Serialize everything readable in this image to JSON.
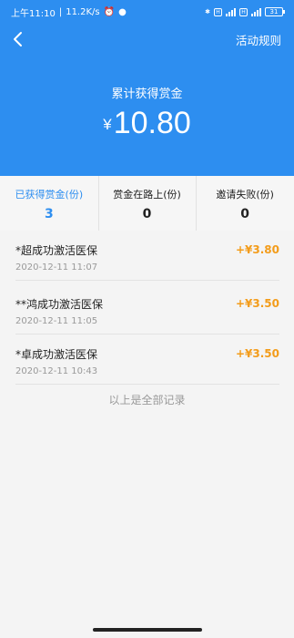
{
  "status_bar": {
    "time": "上午11:10",
    "speed": "11.2K/s",
    "battery": "31"
  },
  "nav": {
    "rules_label": "活动规则"
  },
  "summary": {
    "label": "累计获得赏金",
    "currency": "¥",
    "amount": "10.80"
  },
  "stats": [
    {
      "label": "已获得赏金(份)",
      "value": "3"
    },
    {
      "label": "赏金在路上(份)",
      "value": "0"
    },
    {
      "label": "邀请失败(份)",
      "value": "0"
    }
  ],
  "records": [
    {
      "name": "*超成功激活医保",
      "date": "2020-12-11 11:07",
      "amount": "+¥3.80"
    },
    {
      "name": "**鸿成功激活医保",
      "date": "2020-12-11 11:05",
      "amount": "+¥3.50"
    },
    {
      "name": "*卓成功激活医保",
      "date": "2020-12-11 10:43",
      "amount": "+¥3.50"
    }
  ],
  "footer_note": "以上是全部记录",
  "colors": {
    "primary": "#2d8ef0",
    "amount": "#f39c1a"
  }
}
